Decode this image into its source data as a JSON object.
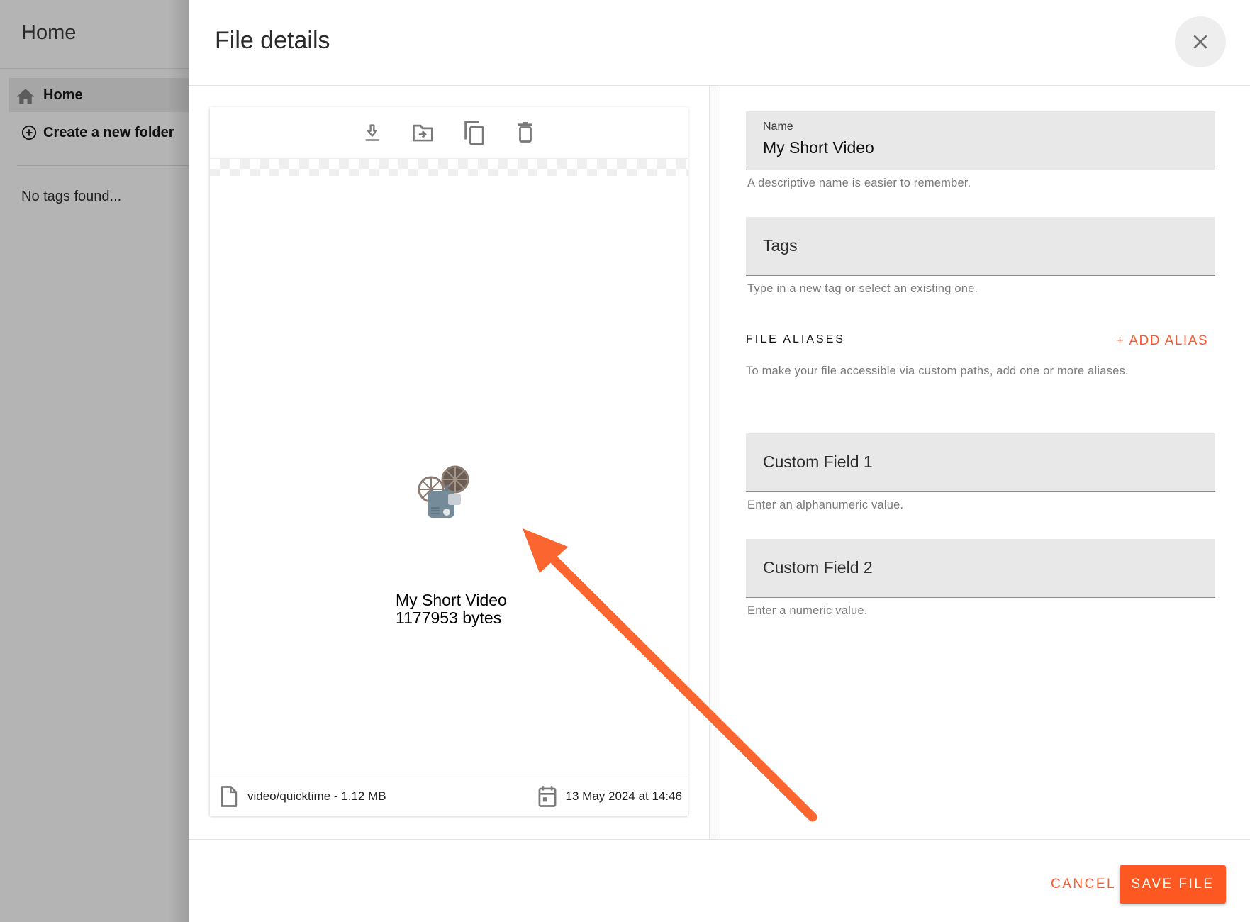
{
  "sidebar": {
    "title": "Home",
    "nav": [
      {
        "label": "Home",
        "icon": "home-icon",
        "active": true
      },
      {
        "label": "Create a new folder",
        "icon": "add-circle-icon",
        "active": false
      }
    ],
    "tags_empty": "No tags found..."
  },
  "dialog": {
    "title": "File details",
    "close_icon": "close-icon",
    "preview": {
      "toolbar": [
        {
          "name": "download",
          "icon": "download-icon"
        },
        {
          "name": "move",
          "icon": "move-to-folder-icon"
        },
        {
          "name": "copy",
          "icon": "copy-icon"
        },
        {
          "name": "delete",
          "icon": "delete-icon"
        }
      ],
      "media_icon": "film-projector-icon",
      "media_emoji": "📽️",
      "caption_name": "My Short Video",
      "caption_size": "1177953 bytes",
      "mime_size": "video/quicktime - 1.12 MB",
      "date": "13 May 2024 at 14:46"
    },
    "form": {
      "name": {
        "label": "Name",
        "value": "My Short Video",
        "helper": "A descriptive name is easier to remember."
      },
      "tags": {
        "placeholder": "Tags",
        "helper": "Type in a new tag or select an existing one."
      },
      "aliases": {
        "title": "FILE ALIASES",
        "add_label": "+ ADD ALIAS",
        "help": "To make your file accessible via custom paths, add one or more aliases."
      },
      "custom1": {
        "placeholder": "Custom Field 1",
        "helper": "Enter an alphanumeric value."
      },
      "custom2": {
        "placeholder": "Custom Field 2",
        "helper": "Enter a numeric value."
      }
    },
    "actions": {
      "cancel": "CANCEL",
      "save": "SAVE FILE"
    }
  },
  "colors": {
    "accent": "#fd5722",
    "annotation_arrow": "#fb6530",
    "overlay_gray": "#b4b4b4"
  }
}
